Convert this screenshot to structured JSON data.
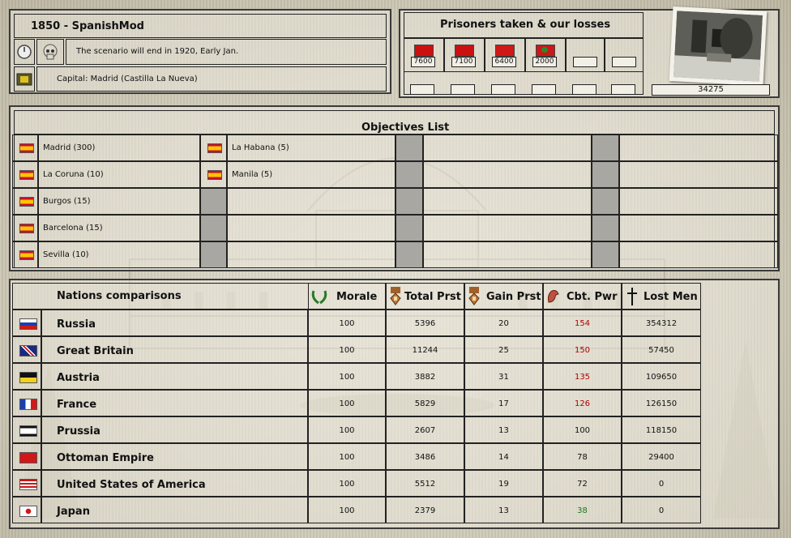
{
  "scenario": {
    "title": "1850 - SpanishMod",
    "end_text": "The scenario will end in 1920, Early Jan.",
    "capital_text": "Capital: Madrid (Castilla La Nueva)"
  },
  "prisoners": {
    "title": "Prisoners taken & our losses",
    "top_values": [
      "7600",
      "7100",
      "6400",
      "2000",
      "",
      ""
    ],
    "bottom_values": [
      "",
      "",
      "",
      "",
      "",
      ""
    ],
    "total": "34275"
  },
  "objectives": {
    "title": "Objectives List",
    "col1": [
      {
        "label": "Madrid (300)"
      },
      {
        "label": "La Coruna (10)"
      },
      {
        "label": "Burgos (15)"
      },
      {
        "label": "Barcelona (15)"
      },
      {
        "label": "Sevilla (10)"
      }
    ],
    "col2": [
      {
        "label": "La Habana (5)"
      },
      {
        "label": "Manila (5)"
      }
    ]
  },
  "nations": {
    "title": "Nations comparisons",
    "headers": {
      "morale": "Morale",
      "total_prst": "Total Prst",
      "gain_prst": "Gain Prst",
      "cbt_pwr": "Cbt. Pwr",
      "lost_men": "Lost Men"
    },
    "rows": [
      {
        "name": "Russia",
        "flag": "russia-flag",
        "morale": "100",
        "total": "5396",
        "gain": "20",
        "cbt": "154",
        "cbt_color": "red",
        "lost": "354312"
      },
      {
        "name": "Great Britain",
        "flag": "uk-flag",
        "morale": "100",
        "total": "11244",
        "gain": "25",
        "cbt": "150",
        "cbt_color": "red",
        "lost": "57450"
      },
      {
        "name": "Austria",
        "flag": "austria-flag",
        "morale": "100",
        "total": "3882",
        "gain": "31",
        "cbt": "135",
        "cbt_color": "red",
        "lost": "109650"
      },
      {
        "name": "France",
        "flag": "france-flag",
        "morale": "100",
        "total": "5829",
        "gain": "17",
        "cbt": "126",
        "cbt_color": "red",
        "lost": "126150"
      },
      {
        "name": "Prussia",
        "flag": "prussia-flag",
        "morale": "100",
        "total": "2607",
        "gain": "13",
        "cbt": "100",
        "cbt_color": "black",
        "lost": "118150"
      },
      {
        "name": "Ottoman Empire",
        "flag": "ottoman-flag",
        "morale": "100",
        "total": "3486",
        "gain": "14",
        "cbt": "78",
        "cbt_color": "black",
        "lost": "29400"
      },
      {
        "name": "United States of America",
        "flag": "usa-flag",
        "morale": "100",
        "total": "5512",
        "gain": "19",
        "cbt": "72",
        "cbt_color": "black",
        "lost": "0"
      },
      {
        "name": "Japan",
        "flag": "japan-flag",
        "morale": "100",
        "total": "2379",
        "gain": "13",
        "cbt": "38",
        "cbt_color": "green",
        "lost": "0"
      }
    ]
  },
  "colors": {
    "red_value": "#b00000",
    "green_value": "#1e7a1e",
    "spain_red": "#c8102e",
    "spain_yellow": "#ffc400"
  }
}
